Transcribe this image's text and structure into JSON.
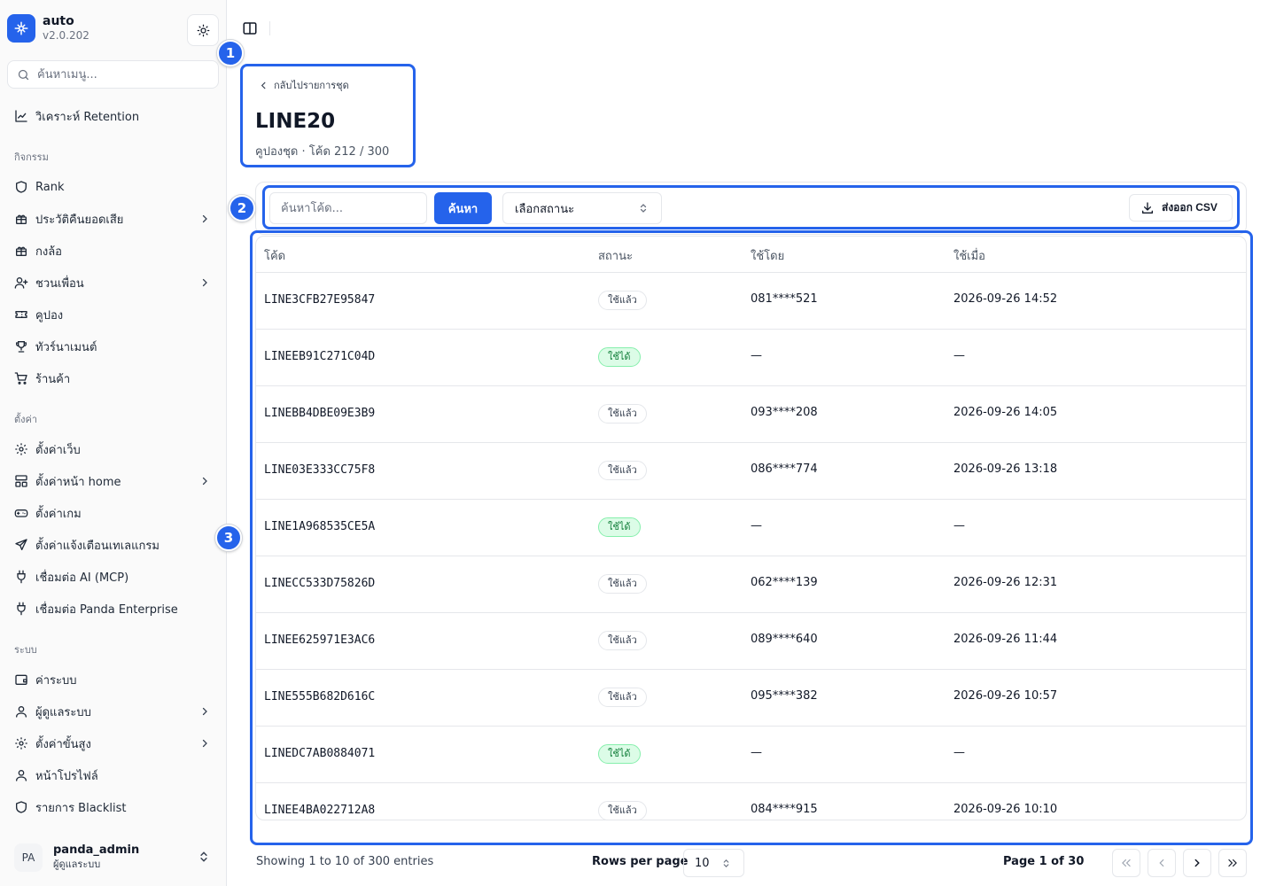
{
  "sidebar": {
    "app_name": "auto",
    "version": "v2.0.202",
    "search_placeholder": "ค้นหาเมนู...",
    "top_item": "วิเคราะห์ Retention",
    "groups": {
      "activity": "กิจกรรม",
      "settings": "ตั้งค่า",
      "system": "ระบบ"
    },
    "activity_items": [
      "Rank",
      "ประวัติคืนยอดเสีย",
      "กงล้อ",
      "ชวนเพื่อน",
      "คูปอง",
      "ทัวร์นาเมนต์",
      "ร้านค้า"
    ],
    "settings_items": [
      "ตั้งค่าเว็บ",
      "ตั้งค่าหน้า home",
      "ตั้งค่าเกม",
      "ตั้งค่าแจ้งเตือนเทเลแกรม",
      "เชื่อมต่อ AI (MCP)",
      "เชื่อมต่อ Panda Enterprise"
    ],
    "system_items": [
      "ค่าระบบ",
      "ผู้ดูแลระบบ",
      "ตั้งค่าขั้นสูง",
      "หน้าโปรไฟล์",
      "รายการ Blacklist"
    ],
    "user": {
      "initials": "PA",
      "name": "panda_admin",
      "role": "ผู้ดูแลระบบ"
    }
  },
  "callouts": [
    "1",
    "2",
    "3"
  ],
  "header": {
    "back_label": "กลับไปรายการชุด",
    "title": "LINE20",
    "subtitle": "คูปองชุด · โค้ด 212 / 300"
  },
  "filters": {
    "code_placeholder": "ค้นหาโค้ด...",
    "search_label": "ค้นหา",
    "status_placeholder": "เลือกสถานะ",
    "export_label": "ส่งออก CSV"
  },
  "table": {
    "columns": [
      "โค้ด",
      "สถานะ",
      "ใช้โดย",
      "ใช้เมื่อ"
    ],
    "rows": [
      {
        "code": "LINE3CFB27E95847",
        "status": "ใช้แล้ว",
        "used_by": "081****521",
        "used_at": "2026-09-26 14:52"
      },
      {
        "code": "LINEEB91C271C04D",
        "status": "ใช้ได้",
        "used_by": "—",
        "used_at": "—"
      },
      {
        "code": "LINEBB4DBE09E3B9",
        "status": "ใช้แล้ว",
        "used_by": "093****208",
        "used_at": "2026-09-26 14:05"
      },
      {
        "code": "LINE03E333CC75F8",
        "status": "ใช้แล้ว",
        "used_by": "086****774",
        "used_at": "2026-09-26 13:18"
      },
      {
        "code": "LINE1A968535CE5A",
        "status": "ใช้ได้",
        "used_by": "—",
        "used_at": "—"
      },
      {
        "code": "LINECC533D75826D",
        "status": "ใช้แล้ว",
        "used_by": "062****139",
        "used_at": "2026-09-26 12:31"
      },
      {
        "code": "LINEE625971E3AC6",
        "status": "ใช้แล้ว",
        "used_by": "089****640",
        "used_at": "2026-09-26 11:44"
      },
      {
        "code": "LINE555B682D616C",
        "status": "ใช้แล้ว",
        "used_by": "095****382",
        "used_at": "2026-09-26 10:57"
      },
      {
        "code": "LINEDC7AB0884071",
        "status": "ใช้ได้",
        "used_by": "—",
        "used_at": "—"
      },
      {
        "code": "LINEE4BA022712A8",
        "status": "ใช้แล้ว",
        "used_by": "084****915",
        "used_at": "2026-09-26 10:10"
      }
    ]
  },
  "pagination": {
    "showing": "Showing 1 to 10 of 300 entries",
    "rows_per_page_label": "Rows per page",
    "rows_per_page_value": "10",
    "page_label": "Page 1 of 30"
  },
  "colors": {
    "accent": "#2563eb",
    "available_bg": "#dcfce7",
    "available_text": "#15803d"
  }
}
